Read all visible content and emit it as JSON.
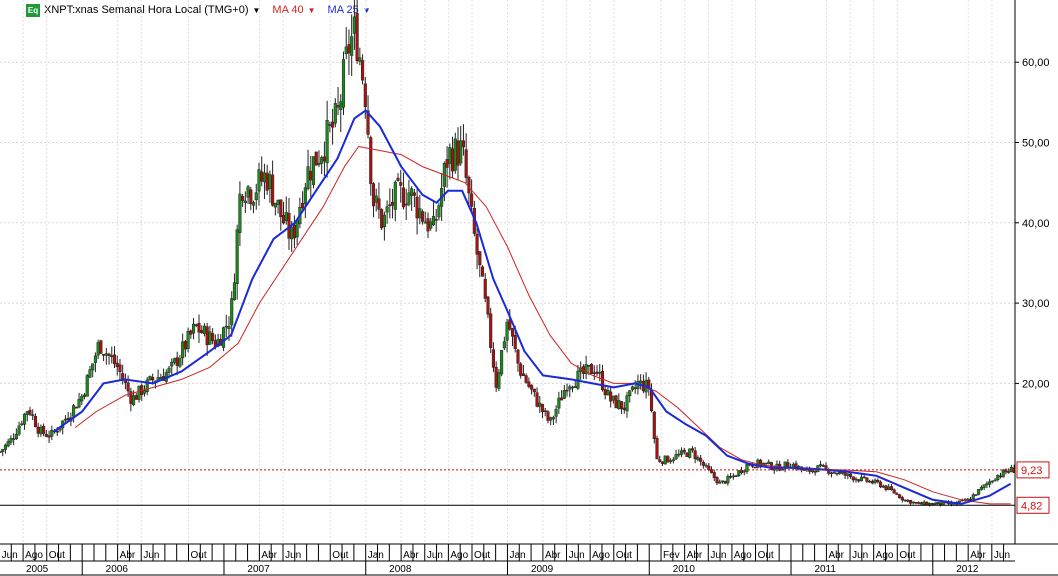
{
  "legend": {
    "badge": "Eq",
    "title": "XNPT:xnas Semanal Hora Local (TMG+0)",
    "ma40_label": "MA 40",
    "ma25_label": "MA 25",
    "ma40_color": "#cc2222",
    "ma25_color": "#1a2ad8",
    "candle_up_color": "#1a8a1a",
    "candle_down_color": "#aa1111"
  },
  "chart_data": {
    "type": "candlestick",
    "ylim": [
      0,
      67
    ],
    "y_ticks": [
      "20,00",
      "30,00",
      "40,00",
      "50,00",
      "60,00"
    ],
    "y_tick_values": [
      20,
      30,
      40,
      50,
      60
    ],
    "price_labels": [
      {
        "value": 9.23,
        "text": "9,23"
      },
      {
        "value": 4.82,
        "text": "4,82"
      }
    ],
    "month_labels": [
      "Jun",
      "Ago",
      "Out",
      "Abr",
      "Jun",
      "Out",
      "Abr",
      "Jun",
      "Out",
      "Jan",
      "Abr",
      "Jun",
      "Ago",
      "Out",
      "Jan",
      "Abr",
      "Jun",
      "Ago",
      "Out",
      "Fev",
      "Abr",
      "Jun",
      "Ago",
      "Out",
      "Abr",
      "Jun",
      "Ago",
      "Out",
      "Abr",
      "Jun"
    ],
    "month_positions": [
      2005.417,
      2005.583,
      2005.75,
      2006.25,
      2006.417,
      2006.75,
      2007.25,
      2007.417,
      2007.75,
      2008.0,
      2008.25,
      2008.417,
      2008.583,
      2008.75,
      2009.0,
      2009.25,
      2009.417,
      2009.583,
      2009.75,
      2010.083,
      2010.25,
      2010.417,
      2010.583,
      2010.75,
      2011.25,
      2011.417,
      2011.583,
      2011.75,
      2012.25,
      2012.417
    ],
    "year_labels": [
      "2005",
      "2006",
      "2007",
      "2008",
      "2009",
      "2010",
      "2011",
      "2012"
    ],
    "year_positions": [
      2005.25,
      2006.25,
      2007.25,
      2008.25,
      2009.25,
      2010.25,
      2011.25,
      2012.25
    ],
    "x_range": [
      2005.42,
      2012.58
    ],
    "price_path": [
      [
        2005.42,
        11.5
      ],
      [
        2005.5,
        13.0
      ],
      [
        2005.62,
        17.0
      ],
      [
        2005.7,
        14.0
      ],
      [
        2005.78,
        13.5
      ],
      [
        2005.9,
        16.0
      ],
      [
        2006.0,
        18.5
      ],
      [
        2006.12,
        25.0
      ],
      [
        2006.25,
        22.0
      ],
      [
        2006.35,
        18.0
      ],
      [
        2006.5,
        20.5
      ],
      [
        2006.62,
        21.5
      ],
      [
        2006.8,
        27.0
      ],
      [
        2006.95,
        25.0
      ],
      [
        2007.05,
        28.5
      ],
      [
        2007.12,
        45.0
      ],
      [
        2007.2,
        44.0
      ],
      [
        2007.3,
        46.0
      ],
      [
        2007.4,
        41.0
      ],
      [
        2007.48,
        38.0
      ],
      [
        2007.58,
        46.0
      ],
      [
        2007.68,
        49.0
      ],
      [
        2007.8,
        53.0
      ],
      [
        2007.88,
        62.0
      ],
      [
        2007.93,
        64.0
      ],
      [
        2008.0,
        56.0
      ],
      [
        2008.05,
        43.0
      ],
      [
        2008.12,
        40.0
      ],
      [
        2008.2,
        43.0
      ],
      [
        2008.3,
        44.0
      ],
      [
        2008.4,
        41.0
      ],
      [
        2008.48,
        39.0
      ],
      [
        2008.58,
        48.5
      ],
      [
        2008.68,
        49.0
      ],
      [
        2008.75,
        40.0
      ],
      [
        2008.85,
        29.0
      ],
      [
        2008.92,
        20.0
      ],
      [
        2009.0,
        28.0
      ],
      [
        2009.08,
        22.0
      ],
      [
        2009.2,
        18.0
      ],
      [
        2009.3,
        15.0
      ],
      [
        2009.42,
        20.0
      ],
      [
        2009.52,
        21.0
      ],
      [
        2009.62,
        22.0
      ],
      [
        2009.72,
        18.0
      ],
      [
        2009.82,
        17.0
      ],
      [
        2009.92,
        20.0
      ],
      [
        2010.0,
        19.5
      ],
      [
        2010.05,
        10.5
      ],
      [
        2010.12,
        10.5
      ],
      [
        2010.2,
        11.0
      ],
      [
        2010.3,
        11.5
      ],
      [
        2010.42,
        9.0
      ],
      [
        2010.5,
        7.5
      ],
      [
        2010.6,
        8.5
      ],
      [
        2010.7,
        10.0
      ],
      [
        2010.8,
        10.0
      ],
      [
        2010.9,
        9.5
      ],
      [
        2011.0,
        10.0
      ],
      [
        2011.1,
        9.0
      ],
      [
        2011.2,
        9.5
      ],
      [
        2011.3,
        9.0
      ],
      [
        2011.4,
        8.5
      ],
      [
        2011.5,
        8.0
      ],
      [
        2011.62,
        7.5
      ],
      [
        2011.72,
        6.5
      ],
      [
        2011.8,
        5.5
      ],
      [
        2011.9,
        5.0
      ],
      [
        2012.0,
        5.0
      ],
      [
        2012.15,
        5.0
      ],
      [
        2012.25,
        5.5
      ],
      [
        2012.35,
        7.0
      ],
      [
        2012.45,
        8.5
      ],
      [
        2012.55,
        9.23
      ]
    ],
    "ma25_path": [
      [
        2005.8,
        14.0
      ],
      [
        2006.0,
        16.5
      ],
      [
        2006.15,
        20.0
      ],
      [
        2006.3,
        20.5
      ],
      [
        2006.5,
        20.0
      ],
      [
        2006.7,
        21.5
      ],
      [
        2006.9,
        24.0
      ],
      [
        2007.05,
        26.0
      ],
      [
        2007.2,
        33.0
      ],
      [
        2007.35,
        38.0
      ],
      [
        2007.5,
        40.0
      ],
      [
        2007.65,
        44.0
      ],
      [
        2007.8,
        48.0
      ],
      [
        2007.92,
        53.0
      ],
      [
        2008.0,
        54.0
      ],
      [
        2008.1,
        52.0
      ],
      [
        2008.25,
        47.0
      ],
      [
        2008.4,
        43.5
      ],
      [
        2008.5,
        42.5
      ],
      [
        2008.58,
        44.0
      ],
      [
        2008.68,
        44.0
      ],
      [
        2008.78,
        40.0
      ],
      [
        2008.9,
        33.0
      ],
      [
        2009.0,
        29.0
      ],
      [
        2009.12,
        24.0
      ],
      [
        2009.25,
        21.0
      ],
      [
        2009.45,
        20.5
      ],
      [
        2009.6,
        20.0
      ],
      [
        2009.75,
        19.5
      ],
      [
        2009.9,
        20.0
      ],
      [
        2010.0,
        19.5
      ],
      [
        2010.12,
        16.5
      ],
      [
        2010.25,
        15.0
      ],
      [
        2010.4,
        13.5
      ],
      [
        2010.55,
        11.0
      ],
      [
        2010.7,
        10.0
      ],
      [
        2010.85,
        9.5
      ],
      [
        2011.0,
        9.5
      ],
      [
        2011.2,
        9.3
      ],
      [
        2011.4,
        9.0
      ],
      [
        2011.6,
        8.5
      ],
      [
        2011.8,
        7.0
      ],
      [
        2012.0,
        5.5
      ],
      [
        2012.2,
        5.0
      ],
      [
        2012.4,
        6.0
      ],
      [
        2012.55,
        7.5
      ]
    ],
    "ma40_path": [
      [
        2005.95,
        14.5
      ],
      [
        2006.1,
        16.5
      ],
      [
        2006.3,
        18.5
      ],
      [
        2006.5,
        19.5
      ],
      [
        2006.7,
        20.5
      ],
      [
        2006.9,
        22.0
      ],
      [
        2007.1,
        25.0
      ],
      [
        2007.25,
        30.0
      ],
      [
        2007.4,
        34.0
      ],
      [
        2007.55,
        38.0
      ],
      [
        2007.7,
        42.0
      ],
      [
        2007.85,
        47.0
      ],
      [
        2007.95,
        49.5
      ],
      [
        2008.1,
        49.0
      ],
      [
        2008.25,
        48.5
      ],
      [
        2008.4,
        47.0
      ],
      [
        2008.55,
        46.0
      ],
      [
        2008.7,
        45.0
      ],
      [
        2008.85,
        42.0
      ],
      [
        2009.0,
        37.0
      ],
      [
        2009.15,
        31.0
      ],
      [
        2009.3,
        26.0
      ],
      [
        2009.45,
        22.5
      ],
      [
        2009.6,
        21.0
      ],
      [
        2009.75,
        20.0
      ],
      [
        2009.9,
        20.0
      ],
      [
        2010.05,
        19.0
      ],
      [
        2010.2,
        17.0
      ],
      [
        2010.35,
        14.5
      ],
      [
        2010.5,
        12.0
      ],
      [
        2010.65,
        10.5
      ],
      [
        2010.8,
        9.8
      ],
      [
        2011.0,
        9.5
      ],
      [
        2011.2,
        9.3
      ],
      [
        2011.4,
        9.2
      ],
      [
        2011.6,
        9.0
      ],
      [
        2011.8,
        8.0
      ],
      [
        2012.0,
        6.5
      ],
      [
        2012.2,
        5.5
      ],
      [
        2012.4,
        5.0
      ],
      [
        2012.55,
        5.0
      ]
    ]
  }
}
